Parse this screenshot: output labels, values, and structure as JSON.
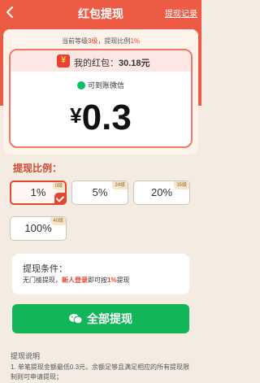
{
  "header": {
    "title": "红包提现",
    "history_link": "提现记录"
  },
  "level_info": {
    "prefix": "当前等级",
    "level": "3级",
    "sep": "，提现比例",
    "ratio": "1%"
  },
  "redpacket": {
    "label": "我的红包：",
    "amount": "30.18元",
    "wechat_label": "可到账微信"
  },
  "withdraw_amount": {
    "currency": "¥",
    "value": "0.3"
  },
  "ratio_section": {
    "title": "提现比例："
  },
  "ratio_options": [
    {
      "label": "1%",
      "badge": "0级",
      "selected": true
    },
    {
      "label": "5%",
      "badge": "24级",
      "selected": false
    },
    {
      "label": "20%",
      "badge": "35级",
      "selected": false
    },
    {
      "label": "100%",
      "badge": "40级",
      "selected": false
    }
  ],
  "condition": {
    "title": "提现条件：",
    "prefix": "无门槛提现，",
    "highlight1": "新人登录",
    "middle": "即可按",
    "highlight2": "1%",
    "suffix": "提现"
  },
  "withdraw_button": {
    "label": "全部提现"
  },
  "notes": {
    "title": "提现说明",
    "line1": "1. 单笔提现金额最低0.3元，余额足够且满足相应的所有提现限制则可申请提现；"
  },
  "colors": {
    "primary": "#ee5b45",
    "accent": "#e6452f",
    "wechat_green": "#12b558"
  },
  "icons": {
    "back": "chevron-left-icon",
    "redpacket": "red-packet-icon",
    "wechat": "wechat-icon",
    "check": "check-icon"
  }
}
